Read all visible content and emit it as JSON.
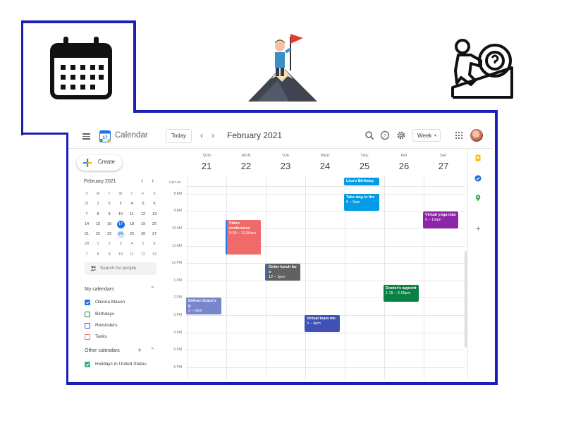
{
  "colors": {
    "frame": "#1a1fb5",
    "primary": "#1a73e8",
    "event_video": "#f06a6a",
    "event_grace": "#7986cb",
    "event_lunch": "#616161",
    "event_team": "#3f51b5",
    "event_birthday": "#039be5",
    "event_dog": "#039be5",
    "event_doctor": "#0b8043",
    "event_yoga": "#8e24aa"
  },
  "top_icons": [
    "calendar-icon",
    "mountain-summit-flag-icon",
    "person-pushing-boulder-uphill-icon"
  ],
  "header": {
    "menu_icon": "hamburger-icon",
    "app_name": "Calendar",
    "logo_text": "17",
    "today": "Today",
    "month": "February 2021",
    "view": "Week"
  },
  "sidebar": {
    "create": "Create",
    "mini": {
      "title": "February 2021",
      "weekdays": [
        "S",
        "M",
        "T",
        "W",
        "T",
        "F",
        "S"
      ],
      "weeks": [
        [
          "31",
          "1",
          "2",
          "3",
          "4",
          "5",
          "6"
        ],
        [
          "7",
          "8",
          "9",
          "10",
          "11",
          "12",
          "13"
        ],
        [
          "14",
          "15",
          "16",
          "17",
          "18",
          "19",
          "20"
        ],
        [
          "21",
          "22",
          "23",
          "24",
          "25",
          "26",
          "27"
        ],
        [
          "28",
          "1",
          "2",
          "3",
          "4",
          "5",
          "6"
        ],
        [
          "7",
          "8",
          "9",
          "10",
          "11",
          "12",
          "13"
        ]
      ]
    },
    "search_placeholder": "Search for people",
    "my_calendars": {
      "title": "My calendars",
      "items": [
        {
          "label": "Olenna Mason",
          "color": "#1a73e8",
          "checked": true
        },
        {
          "label": "Birthdays",
          "color": "#0b8043",
          "checked": false
        },
        {
          "label": "Reminders",
          "color": "#3f51b5",
          "checked": false
        },
        {
          "label": "Tasks",
          "color": "#e67c73",
          "checked": false
        }
      ]
    },
    "other_calendars": {
      "title": "Other calendars",
      "items": [
        {
          "label": "Holidays in United States",
          "color": "#33b679",
          "checked": true
        }
      ]
    }
  },
  "week": {
    "timezone": "GMT-05",
    "days": [
      {
        "dow": "SUN",
        "num": "21"
      },
      {
        "dow": "MON",
        "num": "22"
      },
      {
        "dow": "TUE",
        "num": "23"
      },
      {
        "dow": "WED",
        "num": "24"
      },
      {
        "dow": "THU",
        "num": "25"
      },
      {
        "dow": "FRI",
        "num": "26"
      },
      {
        "dow": "SAT",
        "num": "27"
      }
    ],
    "hours": [
      "8 AM",
      "9 AM",
      "10 AM",
      "11 AM",
      "12 PM",
      "1 PM",
      "2 PM",
      "3 PM",
      "4 PM",
      "5 PM",
      "6 PM"
    ],
    "events": [
      {
        "title": "Lisa's Birthday",
        "time": ""
      },
      {
        "title": "Take dog to the",
        "time": "8 – 9am"
      },
      {
        "title": "Virtual yoga clas",
        "time": "9 – 10am"
      },
      {
        "title": "Video conference",
        "time": "9:30 – 11:30am"
      },
      {
        "title": "Order lunch for o",
        "time": "12 – 1pm"
      },
      {
        "title": "Doctor's appoint",
        "time": "1:15 – 2:15pm"
      },
      {
        "title": "Deliver Grace's g",
        "time": "2 – 3pm"
      },
      {
        "title": "Virtual team me",
        "time": "3 – 4pm"
      }
    ]
  }
}
